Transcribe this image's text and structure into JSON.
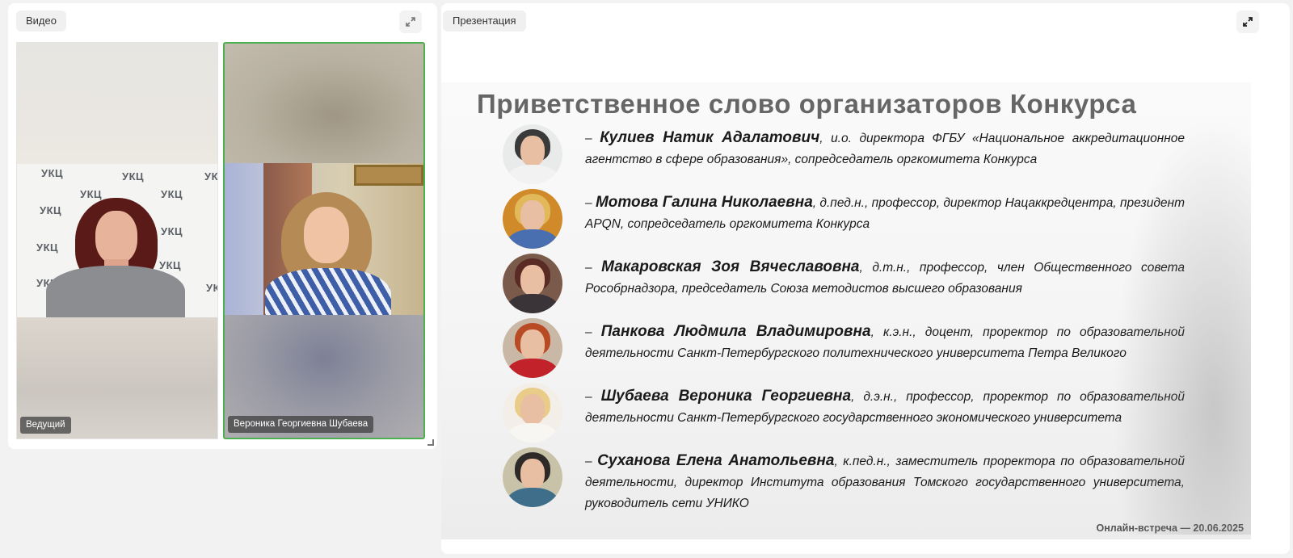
{
  "video_panel": {
    "tag": "Видео",
    "host_label": "Ведущий",
    "guest_label": "Вероника Георгиевна Шубаева",
    "backdrop_logo": "УКЦ"
  },
  "presentation_panel": {
    "tag": "Презентация"
  },
  "slide": {
    "title": "Приветственное слово организаторов Конкурса",
    "footer": "Онлайн-встреча — 20.06.2025",
    "speakers": [
      {
        "dash": "– ",
        "name": "Кулиев Натик Адалатович",
        "desc": ", и.о. директора ФГБУ «Национальное аккредитационное агентство в сфере образования», сопредседатель оргкомитета Конкурса"
      },
      {
        "dash": "– ",
        "name": "Мотова Галина Николаевна",
        "desc": ", д.пед.н., профессор, директор Нацаккредцентра, президент APQN, сопредседатель оргкомитета Конкурса"
      },
      {
        "dash": "– ",
        "name": "Макаровская Зоя Вячеславовна",
        "desc": ", д.т.н., профессор, член Общественного совета Рособрнадзора, председатель Союза методистов высшего образования"
      },
      {
        "dash": "– ",
        "name": "Панкова Людмила Владимировна",
        "desc": ", к.э.н., доцент, проректор по образовательной деятельности Санкт-Петербургского политехнического университета Петра Великого"
      },
      {
        "dash": "– ",
        "name": "Шубаева Вероника Георгиевна",
        "desc": ", д.э.н., профессор, проректор по образовательной деятельности Санкт-Петербургского государственного экономического университета"
      },
      {
        "dash": "– ",
        "name": "Суханова Елена Анатольевна",
        "desc": ", к.пед.н., заместитель проректора по образовательной деятельности, директор Института образования Томского государственного университета, руководитель сети УНИКО"
      }
    ]
  },
  "icons": {
    "expand": "expand-icon",
    "resize": "resize-handle-icon"
  },
  "colors": {
    "active_speaker_border": "#4caf50",
    "panel_background": "#ffffff",
    "page_background": "#f2f2f2",
    "slide_title": "#666666"
  }
}
